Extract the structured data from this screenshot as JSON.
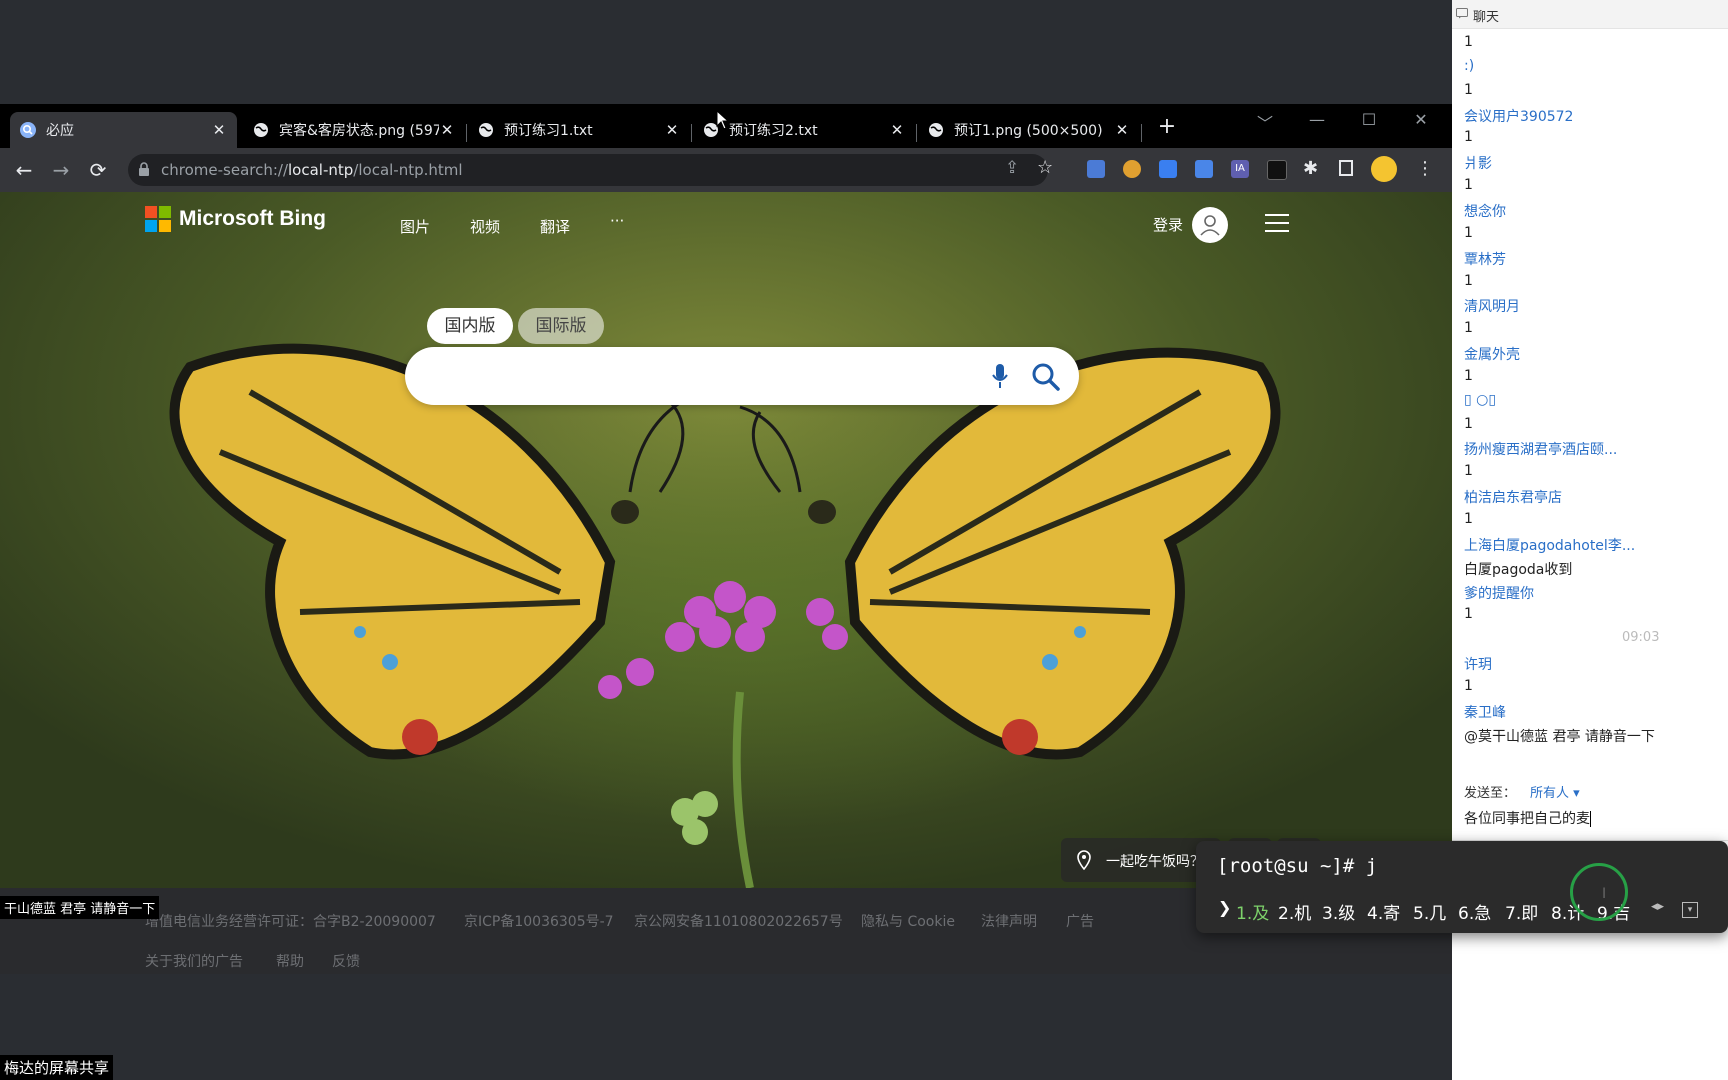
{
  "browser": {
    "tabs": [
      {
        "title": "必应",
        "active": true
      },
      {
        "title": "宾客&客房状态.png (597"
      },
      {
        "title": "预订练习1.txt"
      },
      {
        "title": "预订练习2.txt"
      },
      {
        "title": "预订1.png (500×500)"
      }
    ],
    "new_tab": "+",
    "url_scheme": "chrome-search://",
    "url_host": "local-ntp",
    "url_path": "/local-ntp.html"
  },
  "bing": {
    "logo_text": "Microsoft Bing",
    "nav": [
      "图片",
      "视频",
      "翻译",
      "···"
    ],
    "signin": "登录",
    "region_tabs": [
      "国内版",
      "国际版"
    ],
    "search_placeholder": "",
    "location_text": "一起吃午饭吗？",
    "footer_row1": [
      "增值电信业务经营许可证：合字B2-20090007",
      "京ICP备10036305号-7",
      "京公网安备11010802022657号",
      "隐私与 Cookie",
      "法律声明",
      "广告"
    ],
    "footer_row2": [
      "关于我们的广告",
      "帮助",
      "反馈"
    ]
  },
  "chat": {
    "header": "聊天",
    "messages": [
      {
        "type": "msg",
        "text": "1"
      },
      {
        "type": "name",
        "text": ":)"
      },
      {
        "type": "msg",
        "text": "1"
      },
      {
        "type": "name",
        "text": "会议用户390572"
      },
      {
        "type": "msg",
        "text": "1"
      },
      {
        "type": "name",
        "text": "爿影"
      },
      {
        "type": "msg",
        "text": "1"
      },
      {
        "type": "name",
        "text": "想念你"
      },
      {
        "type": "msg",
        "text": "1"
      },
      {
        "type": "name",
        "text": "覃林芳"
      },
      {
        "type": "msg",
        "text": "1"
      },
      {
        "type": "name",
        "text": "清风明月"
      },
      {
        "type": "msg",
        "text": "1"
      },
      {
        "type": "name",
        "text": "金属外壳"
      },
      {
        "type": "msg",
        "text": "1"
      },
      {
        "type": "name",
        "text": "▯ ○▯"
      },
      {
        "type": "msg",
        "text": "1"
      },
      {
        "type": "name",
        "text": "扬州瘦西湖君亭酒店颐..."
      },
      {
        "type": "msg",
        "text": "1"
      },
      {
        "type": "name",
        "text": "柏洁启东君亭店"
      },
      {
        "type": "msg",
        "text": "1"
      },
      {
        "type": "name",
        "text": "上海白厦pagodahotel李..."
      },
      {
        "type": "msg",
        "text": "白厦pagoda收到"
      },
      {
        "type": "name",
        "text": "爹的提醒你"
      },
      {
        "type": "msg",
        "text": "1"
      },
      {
        "type": "time",
        "text": "09:03"
      },
      {
        "type": "name",
        "text": "许玥"
      },
      {
        "type": "msg",
        "text": "1"
      },
      {
        "type": "name",
        "text": "秦卫峰"
      },
      {
        "type": "msg",
        "text": "@莫干山德蓝 君亭 请静音一下"
      }
    ],
    "send_to_label": "发送至：",
    "send_to_value": "所有人",
    "input_text": "各位同事把自己的麦"
  },
  "ime": {
    "composition": "[root@su ~]# j",
    "candidates": [
      "1.及",
      "2.机",
      "3.级",
      "4.寄",
      "5.几",
      "6.急",
      "7.即",
      "8.计",
      "9.吉"
    ]
  },
  "overlays": {
    "speaker_tag": "干山德蓝 君亭 请静音一下",
    "share_tag": "梅达的屏幕共享"
  },
  "colors": {
    "chrome_tabstrip": "#000000",
    "chrome_toolbar": "#35363a",
    "chat_name": "#2a6fc7",
    "ime_selected": "#7ed36b",
    "ime_ring": "#27a046"
  }
}
